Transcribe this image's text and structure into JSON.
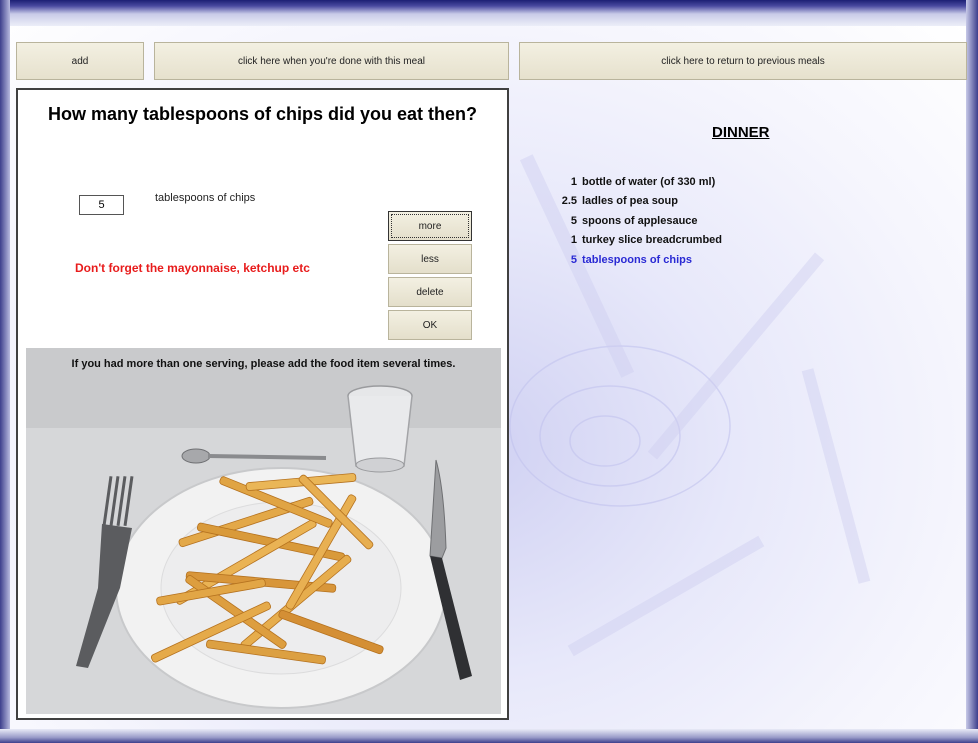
{
  "toolbar": {
    "add_label": "add",
    "done_label": "click here when you're done with this meal",
    "return_label": "click here to return to previous meals"
  },
  "question": "How many tablespoons of chips did you eat then?",
  "quantity": {
    "value": "5",
    "unit": "tablespoons of chips"
  },
  "reminder": "Don't forget the mayonnaise, ketchup etc",
  "buttons": {
    "more": "more",
    "less": "less",
    "delete": "delete",
    "ok": "OK"
  },
  "serving_note": "If you had more than one serving, please add the food item several times.",
  "meal": {
    "title": "DINNER",
    "items": [
      {
        "qty": "1",
        "name": "bottle of water (of 330 ml)"
      },
      {
        "qty": "2.5",
        "name": "ladles of pea soup"
      },
      {
        "qty": "5",
        "name": "spoons of applesauce"
      },
      {
        "qty": "1",
        "name": "turkey slice breadcrumbed"
      },
      {
        "qty": "5",
        "name": "tablespoons of chips"
      }
    ],
    "active_index": 4,
    "active_color": "#2a2ad4"
  },
  "colors": {
    "reminder": "#e81c1c",
    "frame_dark": "#1c1f74"
  }
}
